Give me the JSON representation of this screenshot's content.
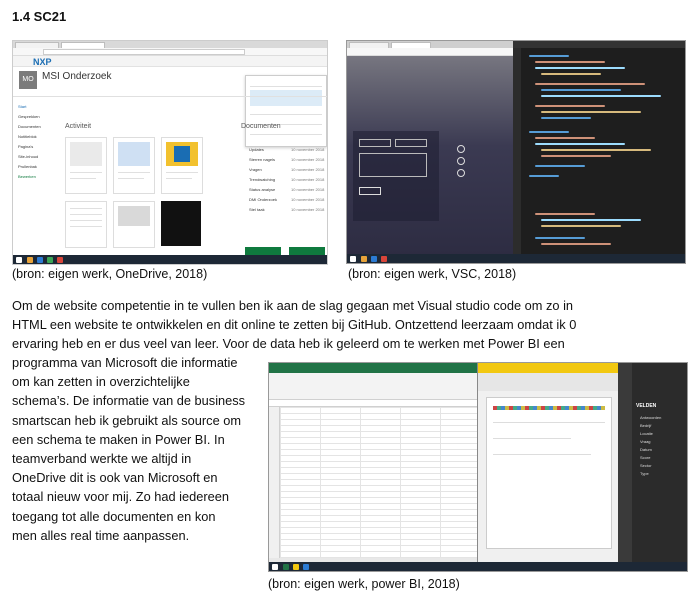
{
  "heading": "1.4 SC21",
  "captions": {
    "onedrive": "(bron: eigen werk, OneDrive, 2018)",
    "vsc": "(bron: eigen werk, VSC, 2018)",
    "powerbi": "(bron: eigen werk, power BI, 2018)"
  },
  "paragraph_full": [
    "Om de website competentie in te vullen ben ik aan de slag gegaan met Visual studio code om zo in",
    "HTML een website te ontwikkelen en dit online te zetten bij GitHub. Ontzettend leerzaam omdat ik 0",
    "ervaring heb en er dus veel van leer. Voor de data heb ik geleerd om te werken met Power BI een"
  ],
  "paragraph_wrapped": [
    "programma van Microsoft die informatie",
    "om kan zetten in overzichtelijke",
    "schema’s. De informatie van de business",
    "smartscan heb ik gebruikt als source om",
    "een schema te maken in Power BI. In",
    "teamverband werkte we altijd in",
    "OneDrive dit is ook van Microsoft en",
    "totaal nieuw voor mij. Zo had iedereen",
    "toegang tot alle documenten en kon",
    "men alles real time aanpassen."
  ],
  "onedrive_shot": {
    "brand": "NXP",
    "site_title": "MSI Onderzoek",
    "avatar_initials": "MO",
    "activity_label": "Activiteit",
    "documents_label": "Documenten",
    "nav_items": [
      "Start",
      "Gesprekken",
      "Documenten",
      "Notitieblok",
      "Pagina's",
      "Site-inhoud",
      "Prullenbak",
      "Bewerken"
    ],
    "doc_rows": [
      "Updates",
      "Sterren nagels",
      "Vragen",
      "Trendwatching",
      "Status analyse",
      "DMI Onderzoek",
      "Stel taak"
    ],
    "doc_dates": [
      "10 november 2018",
      "10 november 2018",
      "10 november 2018",
      "10 november 2018",
      "10 november 2018",
      "10 november 2018",
      "10 november 2018"
    ],
    "accent": "#0f7a3e"
  },
  "vsc_shot": {
    "left_bg": "#3b3a52",
    "editor_bg": "#1e1e1e"
  },
  "powerbi_shot": {
    "panel_title": "VELDEN",
    "fields": [
      "Antwoorden",
      "Bedrijf",
      "Locatie",
      "Vraag",
      "Datum",
      "Score",
      "Sector",
      "Type"
    ],
    "excel_accent": "#217346",
    "pbi_panel_bg": "#2b2b2b"
  }
}
